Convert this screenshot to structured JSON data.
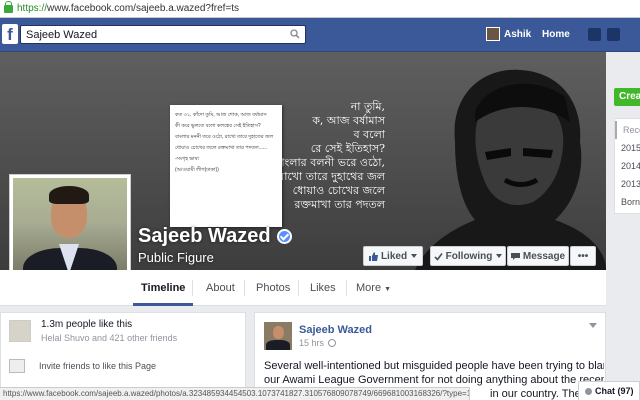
{
  "browser": {
    "url_scheme": "https://",
    "url_rest": "www.facebook.com/sajeeb.a.wazed?fref=ts",
    "status_url": "https://www.facebook.com/sajeeb.a.wazed/photos/a.323485934454503.1073741827.310576809078749/669681003168326/?type=1"
  },
  "topbar": {
    "logo": "f",
    "search_value": "Sajeeb Wazed",
    "user_name": "Ashik",
    "home_label": "Home"
  },
  "cover": {
    "poem_lines": [
      "না তুমি,",
      "ক, আজ বর্ষামাস",
      "ব বলো",
      "রে সেই ইতিহাস?",
      "বাংলার বলনী ভরে ওঠো,",
      "রাখো তারে দুহাথের জল",
      "ধোয়াও চোখের জলে",
      "রক্তমাখা তার পদতল"
    ],
    "note_lines": [
      "কত ৩১, কাঁদো তুমি, আজ শোক, আজ বর্ষামাস",
      "কী করে ভুলতে বলো কলঙ্কের সেই ইতিহাস?",
      "বাংলার মননী তরে ওঠো, রাখো তারে দুহাতের জল",
      "ধোয়াও চোখের জলে রক্তমাখা তার পদতল......",
      "-সংগৃহ ভাষা",
      "(আওয়ামী লীগ(ঢাকা))"
    ]
  },
  "profile": {
    "name": "Sajeeb Wazed",
    "category": "Public Figure"
  },
  "actions": {
    "liked": "Liked",
    "following": "Following",
    "message": "Message",
    "more": "•••"
  },
  "tabs": [
    "Timeline",
    "About",
    "Photos",
    "Likes",
    "More"
  ],
  "likes_card": {
    "count": "1.3m people like this",
    "friends": "Helal Shuvo and 421 other friends",
    "invite": "Invite friends to like this Page"
  },
  "post": {
    "author": "Sajeeb Wazed",
    "time": "15 hrs",
    "lines": [
      "Several well-intentioned but misguided people have been trying to blame",
      "our Awami League Government for not doing anything about the recent",
      "in our country. These people don't seem to realize"
    ]
  },
  "right": {
    "create": "Creat",
    "years": [
      "Rece",
      "2015",
      "2014",
      "2013",
      "Born"
    ]
  },
  "chat": {
    "label": "Chat (97)"
  },
  "colors": {
    "fb_blue": "#3b5998",
    "green": "#42b72a",
    "verified": "#5890ff"
  }
}
